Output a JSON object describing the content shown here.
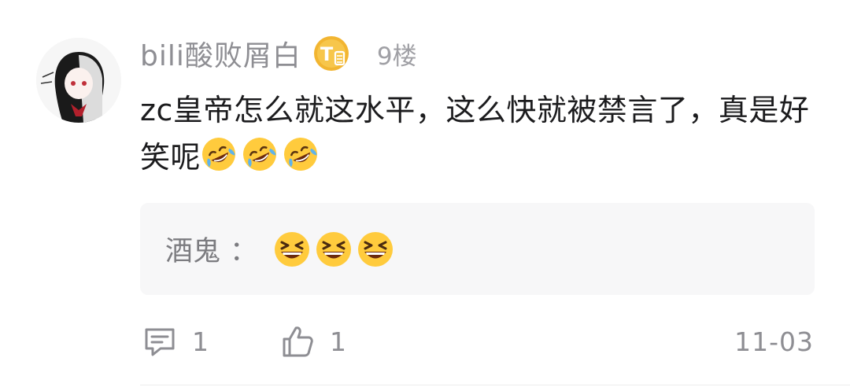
{
  "comment": {
    "username": "bili酸败屑白",
    "level_badge_letter": "T",
    "floor": "9楼",
    "text": "zc皇帝怎么就这水平，这么快就被禁言了，真是好笑呢",
    "text_emojis": [
      "rolling-on-floor-laughing-emoji",
      "rolling-on-floor-laughing-emoji",
      "rolling-on-floor-laughing-emoji"
    ]
  },
  "reply": {
    "author": "酒鬼",
    "separator": "：",
    "emojis": [
      "grinning-squinting-emoji",
      "grinning-squinting-emoji",
      "grinning-squinting-emoji"
    ]
  },
  "actions": {
    "reply_count": "1",
    "like_count": "1",
    "date": "11-03"
  },
  "colors": {
    "badge_gold": "#f2b531",
    "emoji_yellow": "#ffcb3d",
    "muted_text": "#8e8e93",
    "reply_bg": "#f7f7f8"
  }
}
